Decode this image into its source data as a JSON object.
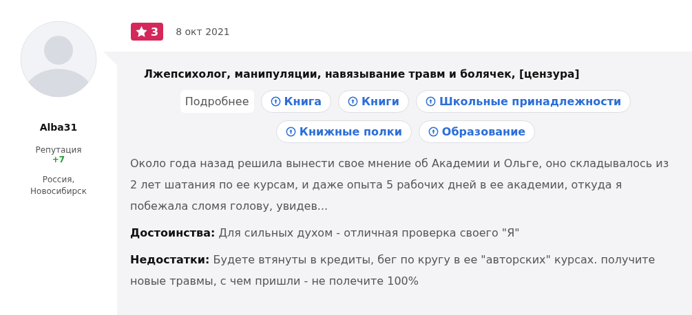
{
  "author": {
    "name": "Alba31",
    "reputation_label": "Репутация",
    "reputation_value": "+7",
    "location": "Россия, Новосибирск"
  },
  "review": {
    "rating": "3",
    "date": "8 окт 2021",
    "title": "Лжепсихолог, манипуляции, навязывание травм и болячек, [цензура]",
    "more_label": "Подробнее",
    "tags": [
      "Книга",
      "Книги",
      "Школьные принадлежности",
      "Книжные полки",
      "Образование"
    ],
    "body": "Около года назад решила вынести свое мнение об Академии и Ольге, оно складывалось из 2 лет шатания по ее курсам, и даже опыта 5 рабочих дней в ее академии, откуда я побежала сломя голову, увидев...",
    "pros": "**Достоинства:** Для сильных духом - отличная проверка своего \"Я\"",
    "cons": "**Недостатки:** Будете втянуты в кредиты, бег по кругу в ее \"авторских\" курсах. получите новые травмы, с чем пришли - не полечите 100%"
  }
}
